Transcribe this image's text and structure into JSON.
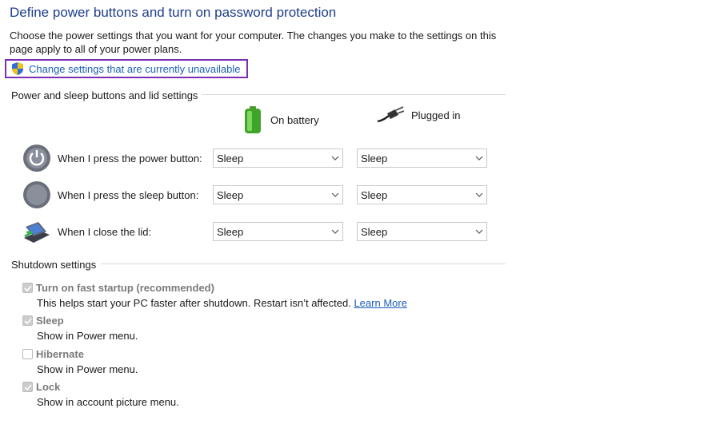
{
  "header": {
    "title": "Define power buttons and turn on password protection",
    "description": "Choose the power settings that you want for your computer. The changes you make to the settings on this page apply to all of your power plans.",
    "change_link": "Change settings that are currently unavailable"
  },
  "power_section": {
    "title": "Power and sleep buttons and lid settings",
    "col_battery": "On battery",
    "col_plugged": "Plugged in",
    "rows": [
      {
        "label": "When I press the power button:",
        "battery": "Sleep",
        "plugged": "Sleep",
        "icon": "power-button-icon"
      },
      {
        "label": "When I press the sleep button:",
        "battery": "Sleep",
        "plugged": "Sleep",
        "icon": "sleep-button-icon"
      },
      {
        "label": "When I close the lid:",
        "battery": "Sleep",
        "plugged": "Sleep",
        "icon": "laptop-lid-icon"
      }
    ]
  },
  "shutdown_section": {
    "title": "Shutdown settings",
    "items": [
      {
        "label": "Turn on fast startup (recommended)",
        "desc": "This helps start your PC faster after shutdown. Restart isn’t affected.",
        "link": "Learn More",
        "checked": true
      },
      {
        "label": "Sleep",
        "desc": "Show in Power menu.",
        "checked": true
      },
      {
        "label": "Hibernate",
        "desc": "Show in Power menu.",
        "checked": false
      },
      {
        "label": "Lock",
        "desc": "Show in account picture menu.",
        "checked": true
      }
    ]
  },
  "colors": {
    "title": "#1e3e8c",
    "link": "#1c5fb8",
    "highlight_border": "#7b2fb4"
  }
}
